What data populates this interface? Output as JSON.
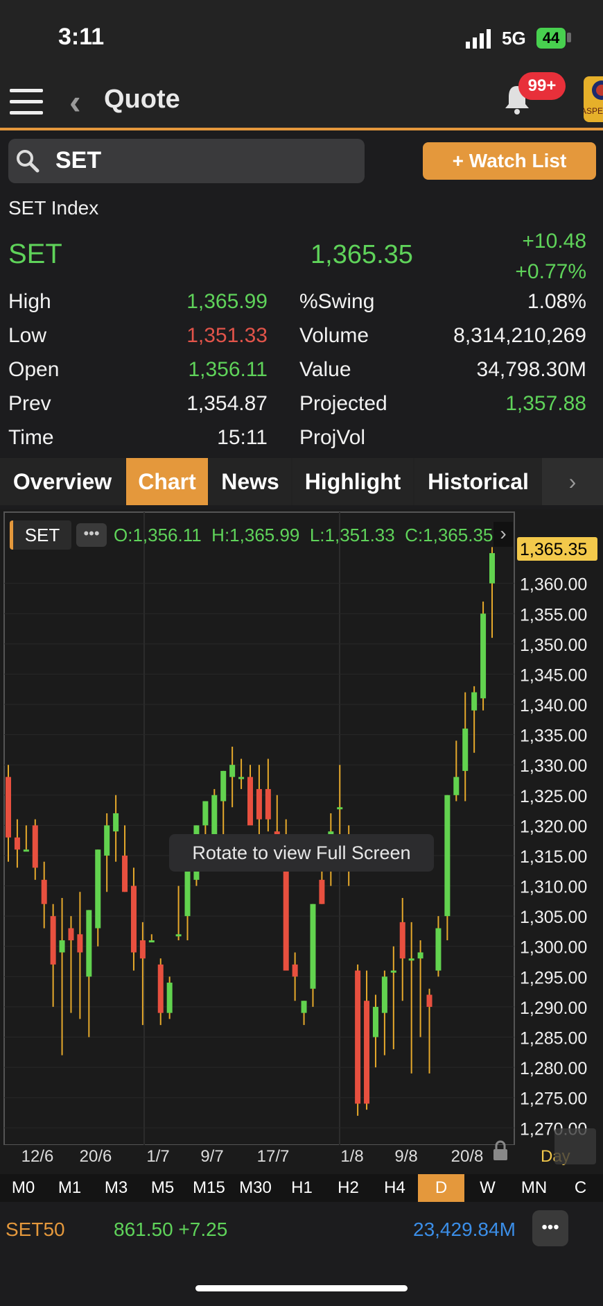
{
  "status_bar": {
    "time": "3:11",
    "network": "5G",
    "battery": "44"
  },
  "header": {
    "title": "Quote",
    "notification_badge": "99+",
    "logo_text": "ASPEN"
  },
  "search": {
    "value": "SET",
    "watchlist_label": "+ Watch List"
  },
  "quote": {
    "name": "SET Index",
    "symbol": "SET",
    "last": "1,365.35",
    "change": "+10.48",
    "change_pct": "+0.77%",
    "left": [
      {
        "label": "High",
        "value": "1,365.99",
        "color": "green"
      },
      {
        "label": "Low",
        "value": "1,351.33",
        "color": "red"
      },
      {
        "label": "Open",
        "value": "1,356.11",
        "color": "green"
      },
      {
        "label": "Prev",
        "value": "1,354.87",
        "color": "white"
      },
      {
        "label": "Time",
        "value": "15:11",
        "color": "white"
      }
    ],
    "right": [
      {
        "label": "%Swing",
        "value": "1.08%",
        "color": "white"
      },
      {
        "label": "Volume",
        "value": "8,314,210,269",
        "color": "white"
      },
      {
        "label": "Value",
        "value": "34,798.30M",
        "color": "white"
      },
      {
        "label": "Projected",
        "value": "1,357.88",
        "color": "green"
      },
      {
        "label": "ProjVol",
        "value": "",
        "color": "white"
      }
    ]
  },
  "tabs": [
    "Overview",
    "Chart",
    "News",
    "Highlight",
    "Historical"
  ],
  "active_tab": "Chart",
  "chart_legend": {
    "symbol": "SET",
    "ohlc": "O:1,356.11  H:1,365.99  L:1,351.33  C:1,365.35"
  },
  "toast": "Rotate to view Full Screen",
  "timeframes": [
    "M0",
    "M1",
    "M3",
    "M5",
    "M15",
    "M30",
    "H1",
    "H2",
    "H4",
    "D",
    "W",
    "MN",
    "C"
  ],
  "active_timeframe": "D",
  "bottom_ticker": {
    "symbol": "SET50",
    "price_change": "861.50 +7.25",
    "value": "23,429.84M"
  },
  "chart_data": {
    "type": "candlestick",
    "current_price_label": "1,365.35",
    "ylim": [
      1270,
      1365
    ],
    "yticks": [
      "1,360.00",
      "1,355.00",
      "1,350.00",
      "1,345.00",
      "1,340.00",
      "1,335.00",
      "1,330.00",
      "1,325.00",
      "1,320.00",
      "1,315.00",
      "1,310.00",
      "1,305.00",
      "1,300.00",
      "1,295.00",
      "1,290.00",
      "1,285.00",
      "1,280.00",
      "1,275.00",
      "1,270.00"
    ],
    "xticks": [
      "12/6",
      "20/6",
      "1/7",
      "9/7",
      "17/7",
      "1/8",
      "9/8",
      "20/8"
    ],
    "x_extra_label": "Day",
    "candles": [
      [
        1328,
        1330,
        1314,
        1318
      ],
      [
        1318,
        1321,
        1313,
        1316
      ],
      [
        1316,
        1320,
        1316,
        1316
      ],
      [
        1320,
        1321,
        1311,
        1313
      ],
      [
        1311,
        1314,
        1303,
        1307
      ],
      [
        1305,
        1307,
        1290,
        1297
      ],
      [
        1299,
        1308,
        1282,
        1301
      ],
      [
        1303,
        1305,
        1289,
        1301
      ],
      [
        1302,
        1309,
        1288,
        1299
      ],
      [
        1295,
        1306,
        1285,
        1306
      ],
      [
        1303,
        1316,
        1300,
        1316
      ],
      [
        1315,
        1322,
        1309,
        1320
      ],
      [
        1319,
        1325,
        1314,
        1322
      ],
      [
        1315,
        1320,
        1309,
        1309
      ],
      [
        1310,
        1313,
        1296,
        1299
      ],
      [
        1301,
        1304,
        1287,
        1298
      ],
      [
        1301,
        1302,
        1301,
        1301
      ],
      [
        1297,
        1298,
        1287,
        1289
      ],
      [
        1289,
        1295,
        1288,
        1294
      ],
      [
        1302,
        1310,
        1301,
        1302
      ],
      [
        1305,
        1312,
        1301,
        1313
      ],
      [
        1311,
        1320,
        1310,
        1320
      ],
      [
        1320,
        1324,
        1317,
        1324
      ],
      [
        1318,
        1326,
        1317,
        1325
      ],
      [
        1324,
        1329,
        1318,
        1329
      ],
      [
        1328,
        1333,
        1323,
        1330
      ],
      [
        1328,
        1331,
        1326,
        1328
      ],
      [
        1328,
        1330,
        1322,
        1320
      ],
      [
        1326,
        1330,
        1318,
        1321
      ],
      [
        1326,
        1331,
        1319,
        1321
      ],
      [
        1319,
        1325,
        1317,
        1317
      ],
      [
        1318,
        1321,
        1297,
        1296
      ],
      [
        1297,
        1299,
        1291,
        1295
      ],
      [
        1289,
        1291,
        1287,
        1291
      ],
      [
        1293,
        1307,
        1290,
        1307
      ],
      [
        1311,
        1314,
        1307,
        1307
      ],
      [
        1314,
        1322,
        1310,
        1319
      ],
      [
        1323,
        1330,
        1317,
        1323
      ],
      [
        1313,
        1320,
        1310,
        1316
      ],
      [
        1296,
        1297,
        1272,
        1274
      ],
      [
        1291,
        1296,
        1273,
        1274
      ],
      [
        1285,
        1292,
        1280,
        1290
      ],
      [
        1289,
        1296,
        1282,
        1295
      ],
      [
        1296,
        1300,
        1283,
        1296
      ],
      [
        1304,
        1308,
        1291,
        1298
      ],
      [
        1298,
        1304,
        1279,
        1298
      ],
      [
        1298,
        1301,
        1285,
        1299
      ],
      [
        1292,
        1293,
        1279,
        1290
      ],
      [
        1296,
        1305,
        1295,
        1303
      ],
      [
        1305,
        1325,
        1301,
        1325
      ],
      [
        1325,
        1334,
        1324,
        1328
      ],
      [
        1329,
        1342,
        1324,
        1336
      ],
      [
        1339,
        1343,
        1332,
        1342
      ],
      [
        1341,
        1357,
        1339,
        1355
      ],
      [
        1360,
        1366,
        1351,
        1365
      ]
    ]
  }
}
